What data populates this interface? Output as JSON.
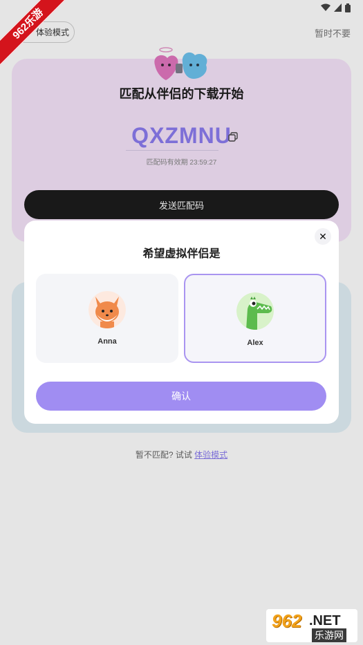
{
  "watermark": {
    "ribbon": "962乐游",
    "logo_number": "962",
    "logo_suffix": ".NET",
    "logo_cn": "乐游网"
  },
  "topbar": {
    "trial_label": "体验模式",
    "skip_label": "暂时不要"
  },
  "pairing": {
    "title": "匹配从伴侣的下载开始",
    "code": "QXZMNU",
    "validity": "匹配码有效期 23:59:27",
    "send_label": "发送匹配码"
  },
  "footer": {
    "prefix": "暂不匹配? 试试 ",
    "link": "体验模式"
  },
  "dialog": {
    "title": "希望虚拟伴侣是",
    "options": [
      {
        "name": "Anna",
        "icon": "fox-avatar-icon",
        "selected": false
      },
      {
        "name": "Alex",
        "icon": "crocodile-avatar-icon",
        "selected": true
      }
    ],
    "confirm_label": "确认",
    "close_symbol": "✕"
  },
  "colors": {
    "accent": "#a08df2",
    "code": "#8c7cf0",
    "card_pink": "#f7e5fb",
    "dark_button": "#1c1c1c"
  }
}
